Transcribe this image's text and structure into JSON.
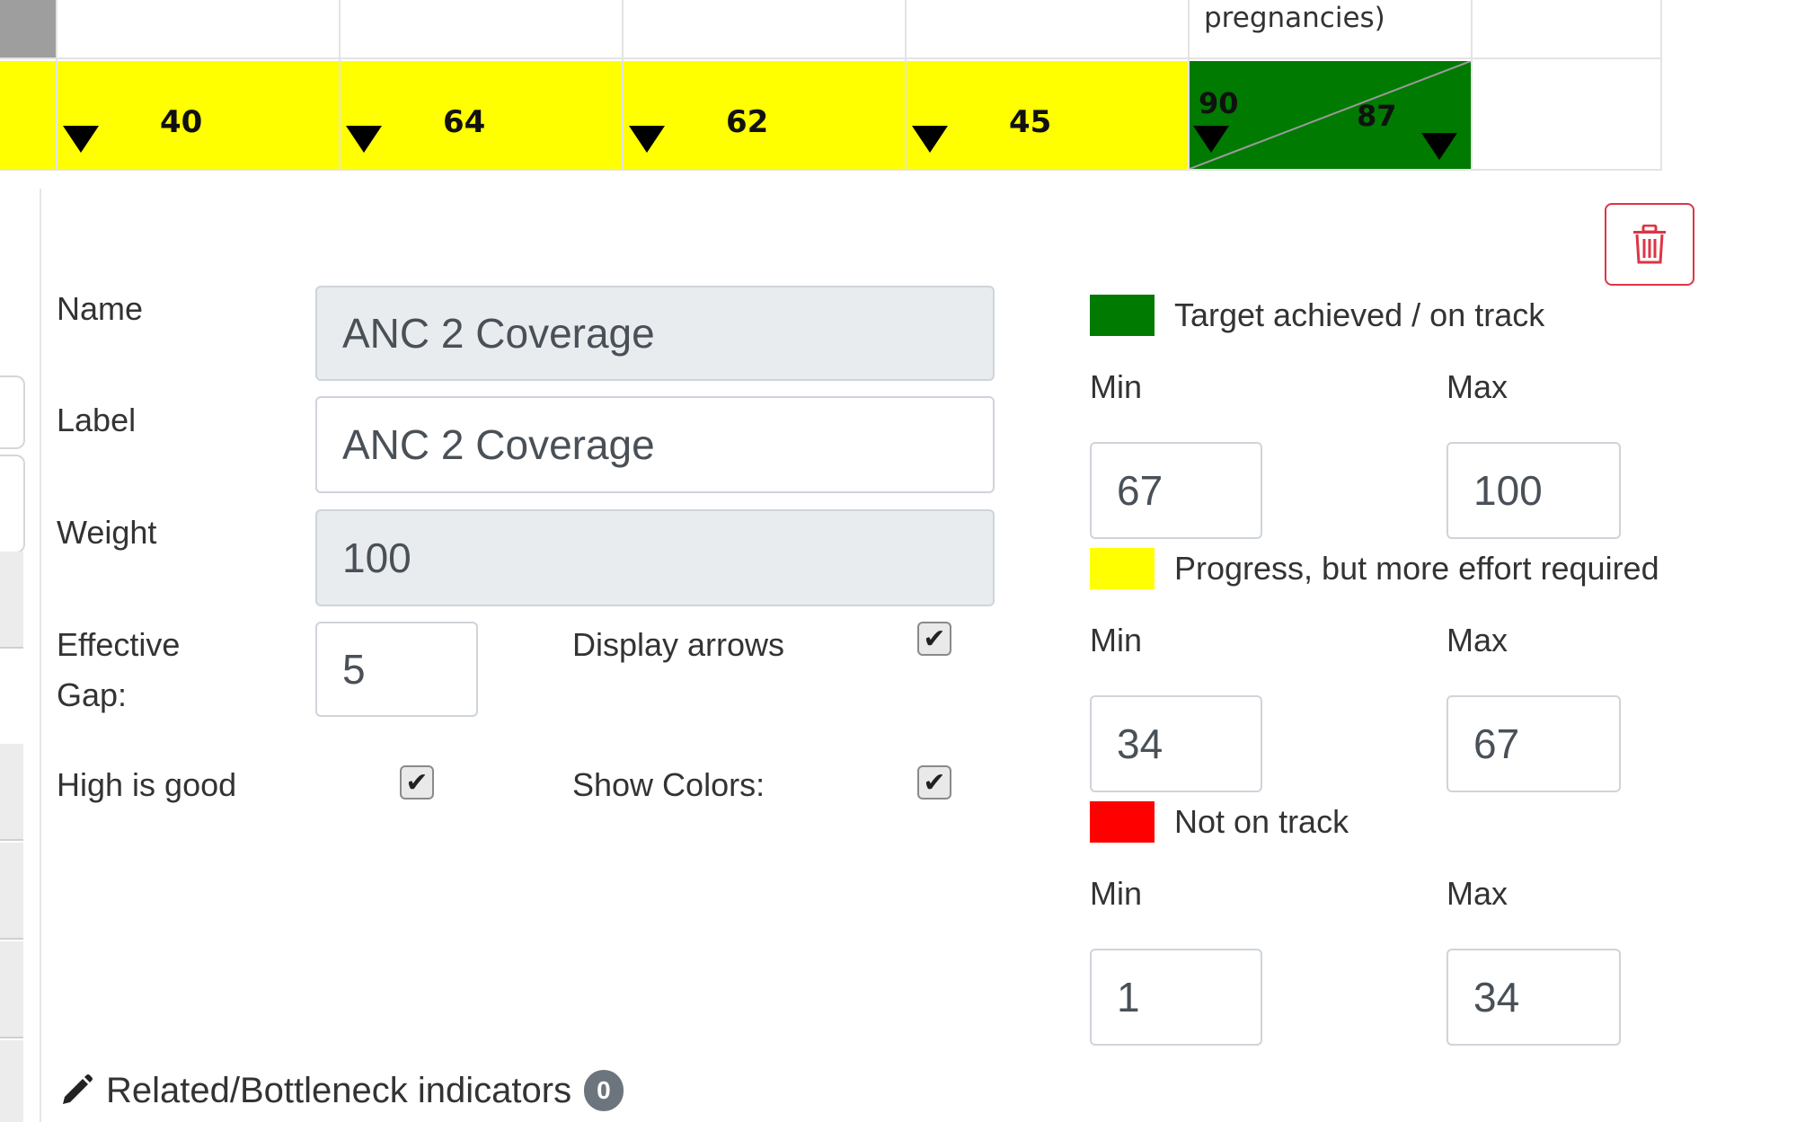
{
  "table": {
    "header_text": "pregnancies)",
    "cells": [
      {
        "value": "40",
        "color": "#ffff00"
      },
      {
        "value": "64",
        "color": "#ffff00"
      },
      {
        "value": "62",
        "color": "#ffff00"
      },
      {
        "value": "45",
        "color": "#ffff00"
      }
    ],
    "split_cell": {
      "left_value": "90",
      "right_value": "87",
      "color": "#007a00"
    }
  },
  "form": {
    "name_label": "Name",
    "name_value": "ANC 2 Coverage",
    "label_label": "Label",
    "label_value": "ANC 2 Coverage",
    "weight_label": "Weight",
    "weight_value": "100",
    "gap_label_line1": "Effective",
    "gap_label_line2": "Gap:",
    "gap_value": "5",
    "display_arrows_label": "Display arrows",
    "display_arrows_checked": true,
    "high_is_good_label": "High is good",
    "high_is_good_checked": true,
    "show_colors_label": "Show Colors:",
    "show_colors_checked": true
  },
  "thresholds": [
    {
      "label": "Target achieved / on track",
      "color": "#007a00",
      "min_label": "Min",
      "max_label": "Max",
      "min": "67",
      "max": "100"
    },
    {
      "label": "Progress, but more effort required",
      "color": "#ffff00",
      "min_label": "Min",
      "max_label": "Max",
      "min": "34",
      "max": "67"
    },
    {
      "label": "Not on track",
      "color": "#ff0000",
      "min_label": "Min",
      "max_label": "Max",
      "min": "1",
      "max": "34"
    }
  ],
  "related": {
    "label": "Related/Bottleneck indicators",
    "count": "0"
  },
  "icons": {
    "delete": "trash-icon",
    "edit": "pencil-icon",
    "arrow": "triangle-down-icon"
  }
}
